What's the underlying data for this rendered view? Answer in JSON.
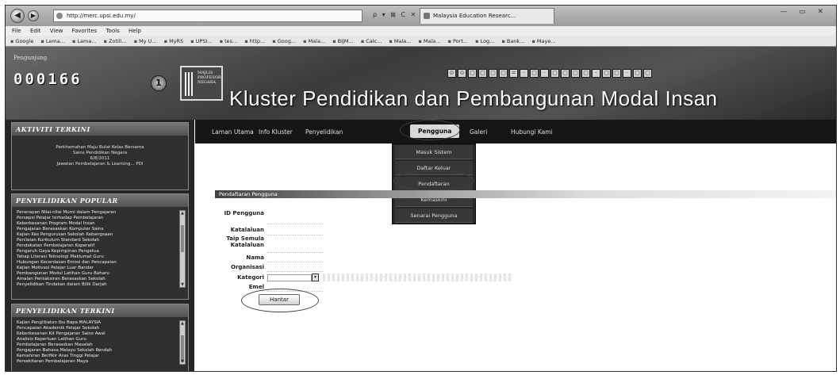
{
  "browser": {
    "address": "http://merc.upsi.edu.my/",
    "address_controls": "ρ ▾ ⊠ C ✕",
    "tab_title": "Malaysia Education Researc...",
    "window_controls": "— ▭ ✕"
  },
  "menubar": [
    "File",
    "Edit",
    "View",
    "Favorites",
    "Tools",
    "Help"
  ],
  "favorites": [
    "Google",
    "Lama...",
    "Lama...",
    "Zotili...",
    "My U...",
    "MyRS",
    "UPSI...",
    "tes...",
    "http...",
    "Goog...",
    "Mala...",
    "BIJM...",
    "Calc...",
    "Mala...",
    "Mala...",
    "Port...",
    "Log...",
    "Bank...",
    "Maye..."
  ],
  "header": {
    "counter_label": "Pengunjung",
    "counter": "000166",
    "logo_text": "MAJLIS PROFESOR NEGARA",
    "deco_glyphs": [
      "⊙",
      "⊙",
      "▢",
      "▢",
      "▢",
      "▢",
      "=",
      "·",
      "▢",
      "·",
      "▢",
      "▢",
      "▢",
      "▢",
      "·",
      "▢",
      "▢",
      "·",
      "▢",
      "▢"
    ],
    "title": "Kluster Pendidikan dan Pembangunan Modal Insan"
  },
  "sidebar": {
    "activity": {
      "heading": "AKTIVITI TERKINI",
      "lines": [
        "Perkhemahan Maju Bulat Kelas Bersama",
        "Sains Pendidikan Negara",
        "6/8/2011",
        "Jawatan Pembelajaran & Learning... PDI"
      ]
    },
    "popular": {
      "heading": "PENYELIDIKAN POPULAR",
      "items": [
        "Penerapan Nilai-nilai Murni dalam Pengajaran",
        "Persepsi Pelajar terhadap Pembelajaran",
        "Keberkesanan Program Modal Insan",
        "Pengajaran Berasaskan Komputer Sains",
        "Kajian Kes Pengurusan Sekolah Kebangsaan",
        "Penilaian Kurikulum Standard Sekolah",
        "Pendekatan Pembelajaran Koperatif",
        "Pengaruh Gaya Kepimpinan Pengetua",
        "Tahap Literasi Teknologi Maklumat Guru",
        "Hubungan Kecerdasan Emosi dan Pencapaian",
        "Kajian Motivasi Pelajar Luar Bandar",
        "Pembangunan Modul Latihan Guru Baharu",
        "Amalan Pentaksiran Berasaskan Sekolah",
        "Penyelidikan Tindakan dalam Bilik Darjah"
      ]
    },
    "latest": {
      "heading": "PENYELIDIKAN TERKINI",
      "items": [
        "Kajian Penglibatan Ibu Bapa MALAYSIA",
        "Pencapaian Akademik Pelajar Sekolah",
        "Keberkesanan Kit Pengajaran Sains Awal",
        "Analisis Keperluan Latihan Guru",
        "Pembelajaran Berasaskan Masalah",
        "Pengajaran Bahasa Melayu Sekolah Rendah",
        "Kemahiran Berfikir Aras Tinggi Pelajar",
        "Persekitaran Pembelajaran Maya"
      ]
    }
  },
  "nav": {
    "items": [
      "Laman Utama",
      "Info Kluster",
      "Penyelidikan",
      "Pengguna",
      "Galeri",
      "Hubungi Kami"
    ],
    "active_index": 3
  },
  "dropdown": [
    "Masuk Sistem",
    "Daftar Keluar",
    "Pendaftaran",
    "Kemaskini",
    "Senarai Pengguna"
  ],
  "form": {
    "title": "Pendaftaran Pengguna",
    "labels": [
      "ID Pengguna",
      "Katalaluan",
      "Taip Semula Katalaluan",
      "Nama",
      "Organisasi",
      "Kategori",
      "Emel"
    ],
    "submit_label": "Hantar"
  }
}
